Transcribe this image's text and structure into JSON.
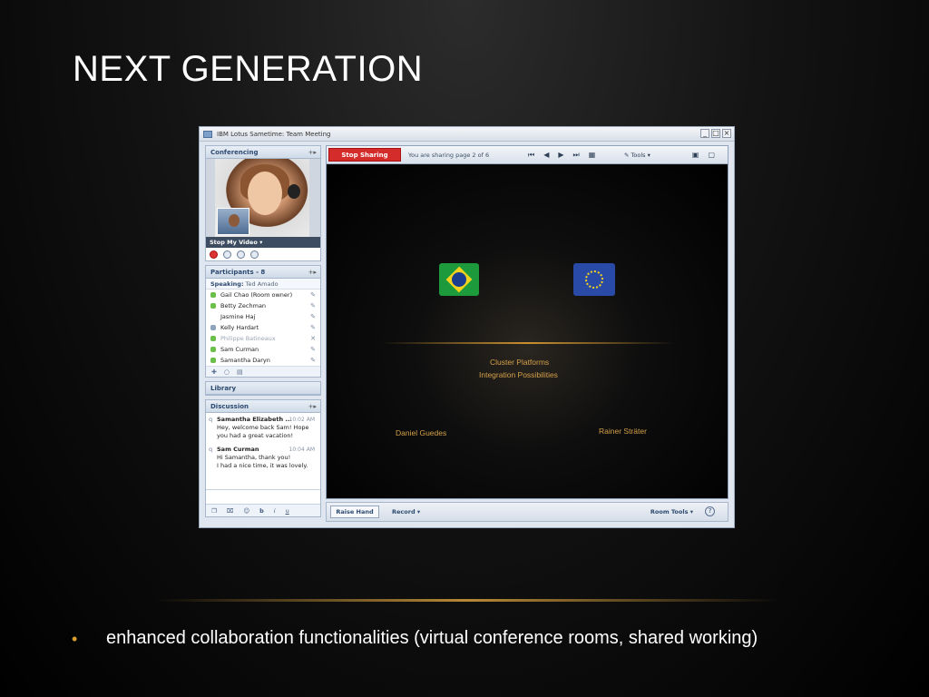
{
  "slide": {
    "title": "NEXT GENERATION",
    "bullets": [
      "enhanced collaboration functionalities (virtual conference rooms, shared working)"
    ],
    "bullet_color": "#d9a02e"
  },
  "window": {
    "title": "IBM Lotus Sametime: Team Meeting",
    "controls": [
      "_",
      "□",
      "×"
    ]
  },
  "conferencing": {
    "header": "Conferencing",
    "collapse": "+▸",
    "video_label": "Stop My Video ▾"
  },
  "participants": {
    "header": "Participants - 8",
    "speaking_label": "Speaking:",
    "speaking_value": "Ted Amado",
    "list": [
      {
        "name": "Gail Chao (Room owner)",
        "status": "online"
      },
      {
        "name": "Betty Zechman",
        "status": "online"
      },
      {
        "name": "Jasmine Haj",
        "status": "none"
      },
      {
        "name": "Kelly Hardart",
        "status": "mobile"
      },
      {
        "name": "Philippe Batineaux",
        "status": "dim"
      },
      {
        "name": "Sam Curman",
        "status": "online"
      },
      {
        "name": "Samantha Daryn",
        "status": "online"
      }
    ]
  },
  "library": {
    "header": "Library"
  },
  "discussion": {
    "header": "Discussion",
    "messages": [
      {
        "who": "Samantha Elizabeth ...",
        "time": "10:02 AM",
        "lines": [
          "Hey, welcome back Sam! Hope",
          "you had a great vacation!"
        ]
      },
      {
        "who": "Sam Curman",
        "time": "10:04 AM",
        "lines": [
          "Hi Samantha, thank you!",
          "I had a nice time, it was lovely."
        ]
      }
    ],
    "format_tools": [
      "b",
      "i",
      "u"
    ]
  },
  "sharing": {
    "stop_label": "Stop Sharing",
    "status": "You are sharing page 2 of 6",
    "tools_label": "Tools ▾"
  },
  "stage": {
    "line1": "Cluster Platforms",
    "line2": "Integration  Possibilities",
    "name_left": "Daniel Guedes",
    "name_right": "Rainer Sträter"
  },
  "bottom": {
    "raise_hand": "Raise Hand",
    "record": "Record ▾",
    "room_tools": "Room Tools ▾",
    "help": "?"
  },
  "colors": {
    "accent_red": "#d42b2b",
    "stage_text": "#d4a049",
    "panel_header": "#2d4a70"
  }
}
